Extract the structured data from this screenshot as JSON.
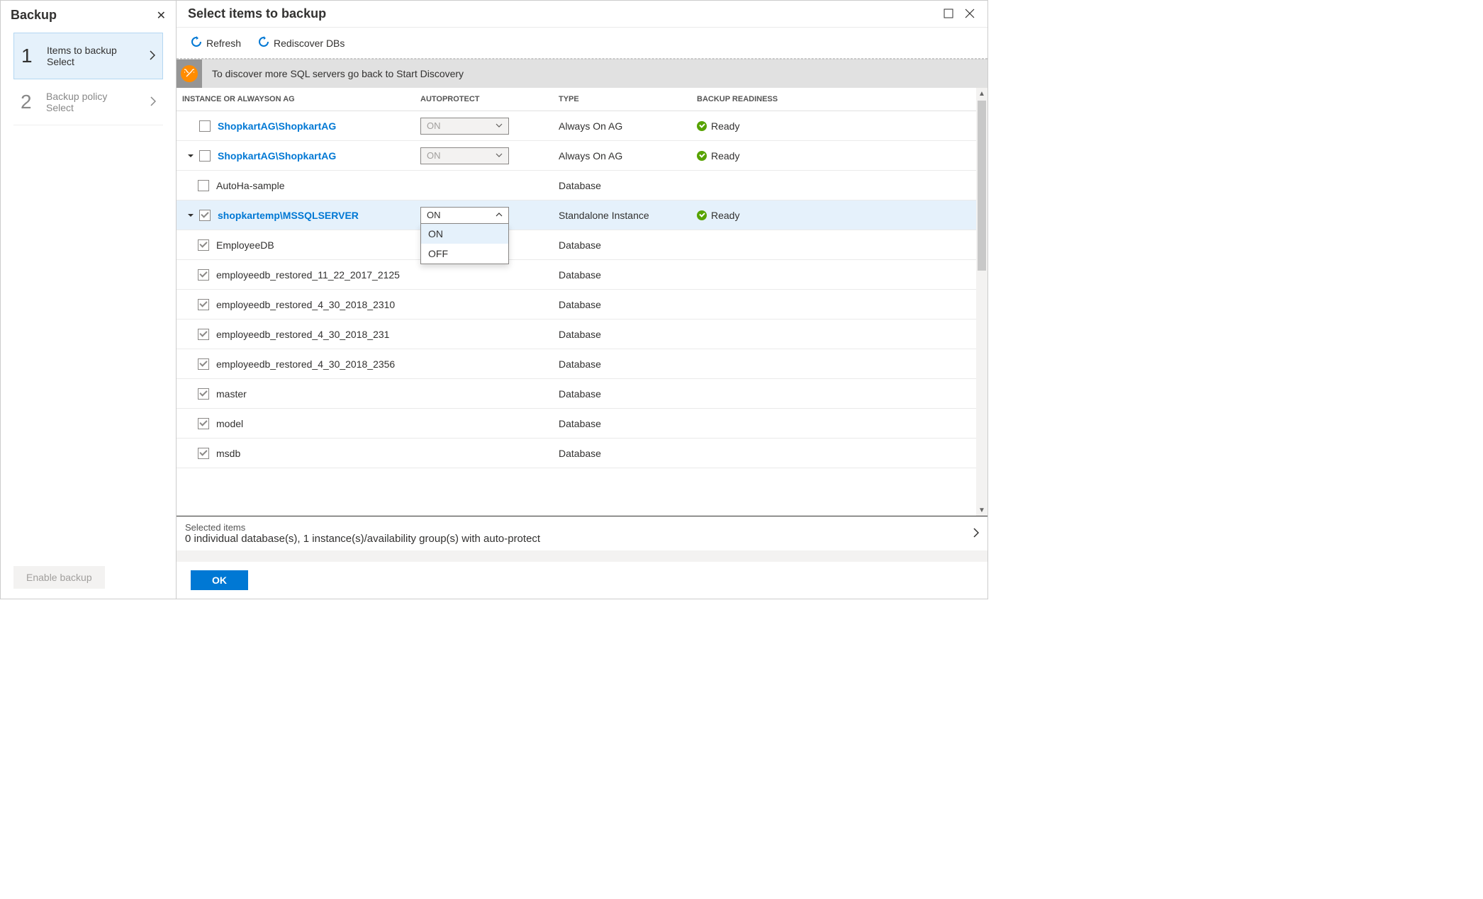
{
  "sidebar": {
    "title": "Backup",
    "steps": [
      {
        "num": "1",
        "title": "Items to backup",
        "sub": "Select"
      },
      {
        "num": "2",
        "title": "Backup policy",
        "sub": "Select"
      }
    ],
    "enable_label": "Enable backup"
  },
  "main": {
    "title": "Select items to backup",
    "toolbar": {
      "refresh": "Refresh",
      "rediscover": "Rediscover DBs"
    },
    "banner": "To discover more SQL servers go back to Start Discovery",
    "columns": {
      "instance": "INSTANCE OR ALWAYSON AG",
      "autoprotect": "AUTOPROTECT",
      "type": "TYPE",
      "readiness": "BACKUP READINESS"
    },
    "rows": [
      {
        "name": "ShopkartAG\\ShopkartAG",
        "isInstance": true,
        "checked": false,
        "expandable": false,
        "indent": 0,
        "autoprotect": "ON",
        "autoDisabled": true,
        "type": "Always On AG",
        "ready": "Ready"
      },
      {
        "name": "ShopkartAG\\ShopkartAG",
        "isInstance": true,
        "checked": false,
        "expandable": true,
        "indent": 0,
        "autoprotect": "ON",
        "autoDisabled": true,
        "type": "Always On AG",
        "ready": "Ready"
      },
      {
        "name": "AutoHa-sample",
        "isInstance": false,
        "checked": false,
        "expandable": false,
        "indent": 1,
        "type": "Database"
      },
      {
        "name": "shopkartemp\\MSSQLSERVER",
        "isInstance": true,
        "checked": true,
        "expandable": true,
        "indent": 0,
        "autoprotect": "ON",
        "autoDisabled": false,
        "autoOpen": true,
        "type": "Standalone Instance",
        "ready": "Ready",
        "selected": true
      },
      {
        "name": "EmployeeDB",
        "isInstance": false,
        "checked": true,
        "expandable": false,
        "indent": 1,
        "type": "Database"
      },
      {
        "name": "employeedb_restored_11_22_2017_2125",
        "isInstance": false,
        "checked": true,
        "expandable": false,
        "indent": 1,
        "type": "Database"
      },
      {
        "name": "employeedb_restored_4_30_2018_2310",
        "isInstance": false,
        "checked": true,
        "expandable": false,
        "indent": 1,
        "type": "Database"
      },
      {
        "name": "employeedb_restored_4_30_2018_231",
        "isInstance": false,
        "checked": true,
        "expandable": false,
        "indent": 1,
        "type": "Database"
      },
      {
        "name": "employeedb_restored_4_30_2018_2356",
        "isInstance": false,
        "checked": true,
        "expandable": false,
        "indent": 1,
        "type": "Database"
      },
      {
        "name": "master",
        "isInstance": false,
        "checked": true,
        "expandable": false,
        "indent": 1,
        "type": "Database"
      },
      {
        "name": "model",
        "isInstance": false,
        "checked": true,
        "expandable": false,
        "indent": 1,
        "type": "Database"
      },
      {
        "name": "msdb",
        "isInstance": false,
        "checked": true,
        "expandable": false,
        "indent": 1,
        "type": "Database"
      }
    ],
    "dropdown_options": {
      "on": "ON",
      "off": "OFF"
    },
    "selected": {
      "label": "Selected items",
      "desc": "0 individual database(s), 1 instance(s)/availability group(s) with auto-protect"
    },
    "ok": "OK"
  }
}
